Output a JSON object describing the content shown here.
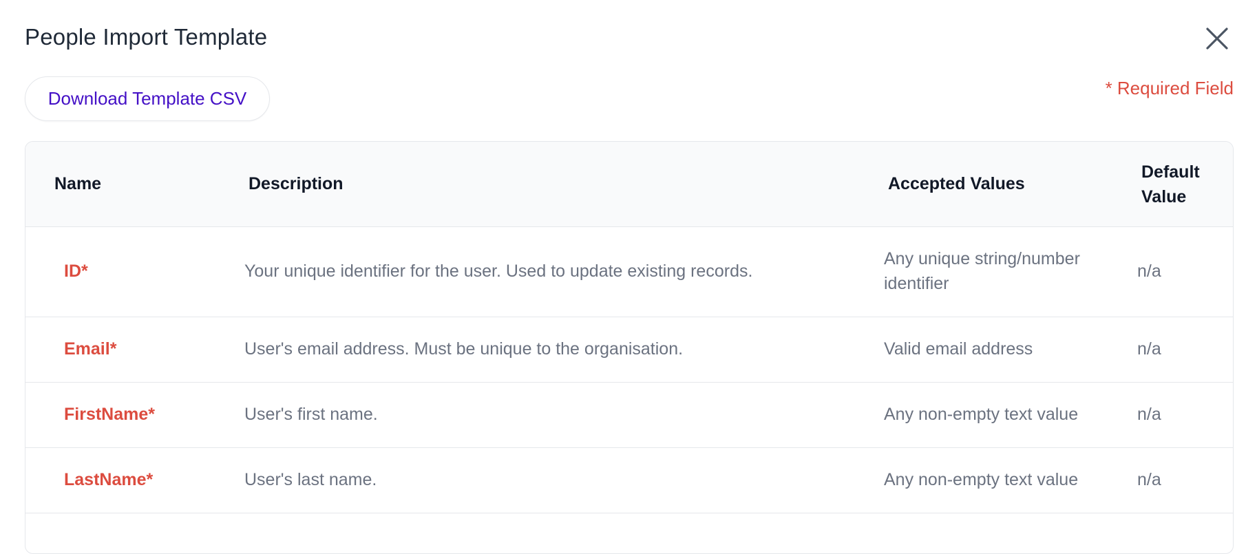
{
  "modal": {
    "title": "People Import Template",
    "download_button_label": "Download Template CSV",
    "required_note": "* Required Field",
    "close_icon": "close-icon"
  },
  "table": {
    "headers": {
      "name": "Name",
      "description": "Description",
      "accepted_values": "Accepted Values",
      "default_value": "Default Value"
    },
    "rows": [
      {
        "name": "ID*",
        "description": "Your unique identifier for the user. Used to update existing records.",
        "accepted_values": "Any unique string/number identifier",
        "default_value": "n/a"
      },
      {
        "name": "Email*",
        "description": "User's email address. Must be unique to the organisation.",
        "accepted_values": "Valid email address",
        "default_value": "n/a"
      },
      {
        "name": "FirstName*",
        "description": "User's first name.",
        "accepted_values": "Any non-empty text value",
        "default_value": "n/a"
      },
      {
        "name": "LastName*",
        "description": "User's last name.",
        "accepted_values": "Any non-empty text value",
        "default_value": "n/a"
      }
    ]
  },
  "colors": {
    "required_red": "#dc4c3f",
    "accent_purple": "#4410c6",
    "muted_text": "#6b7280",
    "header_bg": "#f9fafb"
  }
}
